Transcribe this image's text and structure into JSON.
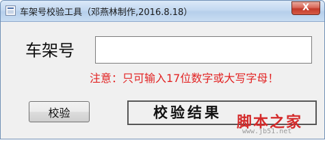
{
  "window": {
    "title": "车架号校验工具（邓燕林制作,2016.8.18）",
    "close_label": "X"
  },
  "form": {
    "vin_label": "车架号",
    "vin_value": "",
    "hint": "注意：只可输入17位数字或大写字母！",
    "verify_button": "校验",
    "result_text": "校验结果"
  },
  "watermark": {
    "text": "脚本之家",
    "url": "www.jb51.net"
  },
  "colors": {
    "hint": "#e22222",
    "watermark": "#d42b2b",
    "close": "#c33a2a"
  },
  "icons": {
    "app": "app-window-icon",
    "close": "close-x"
  }
}
